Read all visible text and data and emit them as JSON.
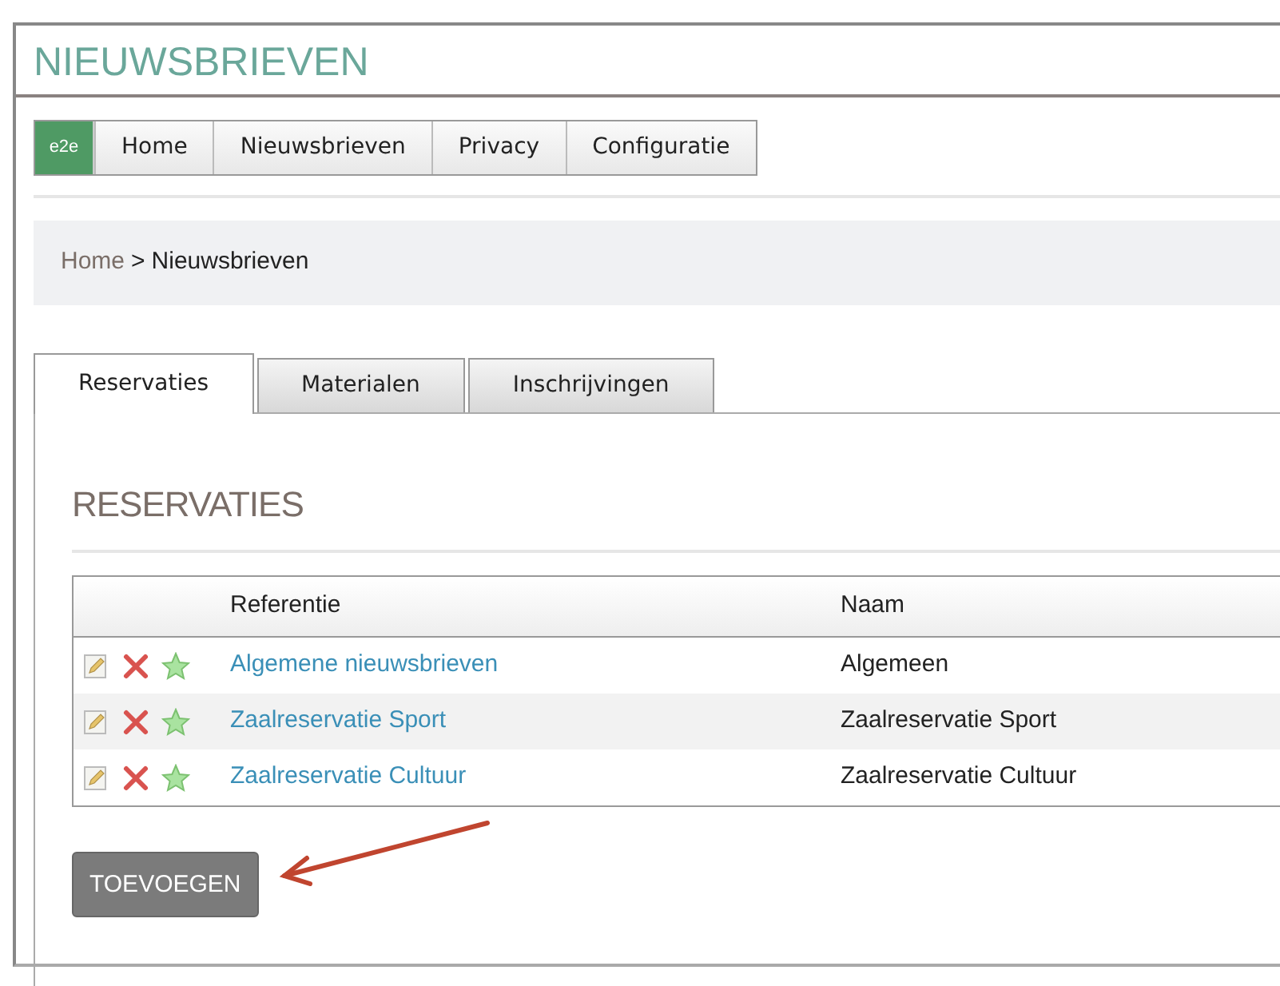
{
  "page_title": "NIEUWSBRIEVEN",
  "logo": "e2e",
  "nav": [
    "Home",
    "Nieuwsbrieven",
    "Privacy",
    "Configuratie"
  ],
  "breadcrumb": {
    "link": "Home",
    "separator": ">",
    "current": "Nieuwsbrieven"
  },
  "tabs": [
    {
      "label": "Reservaties",
      "selected": true
    },
    {
      "label": "Materialen",
      "selected": false
    },
    {
      "label": "Inschrijvingen",
      "selected": false
    }
  ],
  "section_title": "RESERVATIES",
  "table": {
    "columns": [
      "Referentie",
      "Naam"
    ],
    "rows": [
      {
        "referentie": "Algemene nieuwsbrieven",
        "naam": "Algemeen"
      },
      {
        "referentie": "Zaalreservatie Sport",
        "naam": "Zaalreservatie Sport"
      },
      {
        "referentie": "Zaalreservatie Cultuur",
        "naam": "Zaalreservatie Cultuur"
      }
    ]
  },
  "add_button": "TOEVOEGEN"
}
